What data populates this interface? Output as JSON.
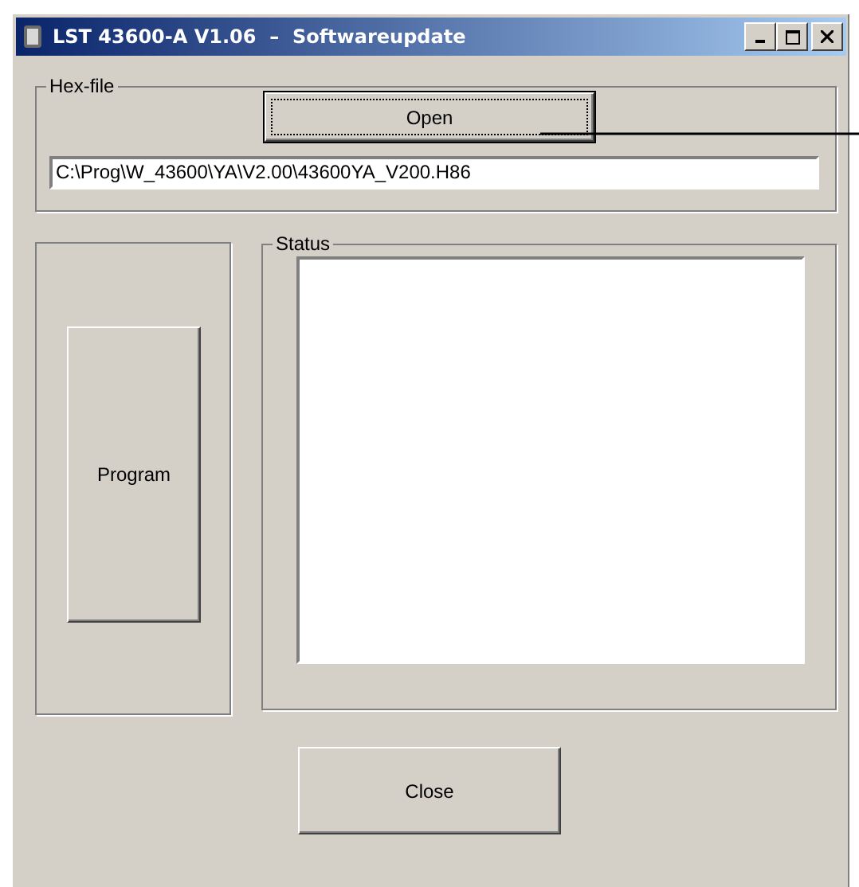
{
  "window": {
    "title": "LST 43600-A V1.06  –  Softwareupdate"
  },
  "hex_file": {
    "label": "Hex-file",
    "open_button": {
      "label": "Open",
      "focused": true
    },
    "path": "C:\\Prog\\W_43600\\YA\\V2.00\\43600YA_V200.H86"
  },
  "program_button": "Program",
  "status": {
    "label": "Status"
  },
  "close_button": "Close"
}
